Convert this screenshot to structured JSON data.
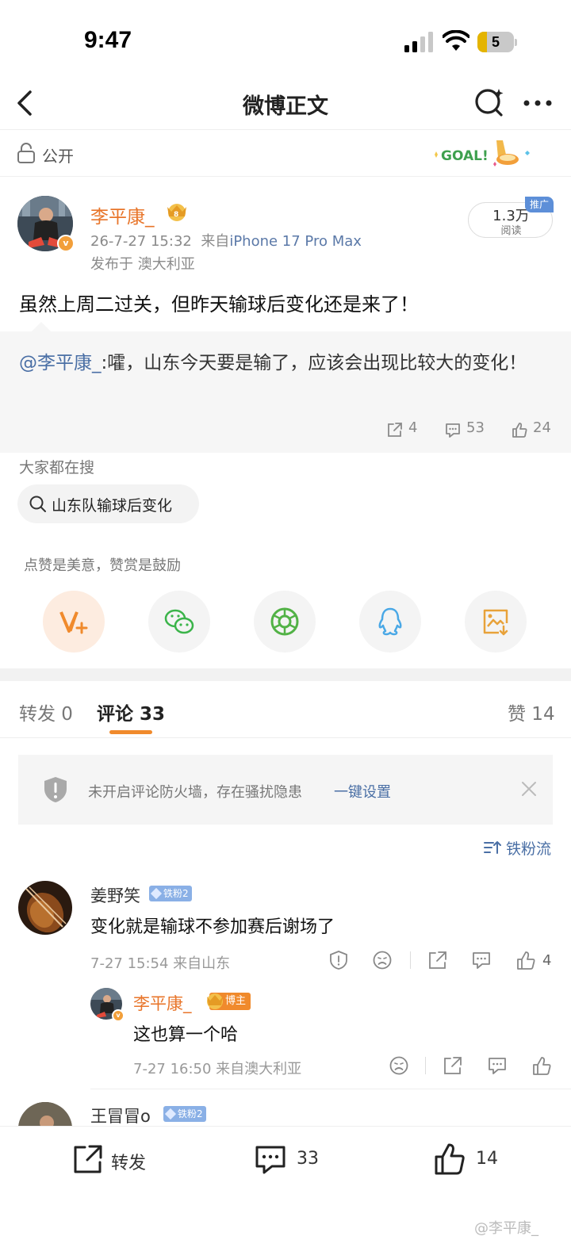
{
  "status_bar": {
    "time": "9:47",
    "battery": "5"
  },
  "nav": {
    "title": "微博正文"
  },
  "visibility": {
    "label": "公开",
    "badge_text": "GOAL!"
  },
  "post": {
    "author": "李平康_",
    "timestamp": "26-7-27 15:32",
    "source_prefix": "来自",
    "device": "iPhone 17 Pro Max",
    "location": "发布于 澳大利亚",
    "reads_count": "1.3万",
    "reads_label": "阅读",
    "promo_tag": "推广",
    "text": "虽然上周二过关，但昨天输球后变化还是来了！"
  },
  "repost": {
    "mention": "@李平康_",
    "text": ":嚯，山东今天要是输了，应该会出现比较大的变化！",
    "shares": "4",
    "comments": "53",
    "likes": "24"
  },
  "search": {
    "heading": "大家都在搜",
    "chip": "山东队输球后变化"
  },
  "reward": {
    "tip": "点赞是美意，赞赏是鼓励"
  },
  "share_targets": [
    {
      "icon": "reward-icon"
    },
    {
      "icon": "wechat-icon"
    },
    {
      "icon": "moments-icon"
    },
    {
      "icon": "qq-icon"
    },
    {
      "icon": "save-image-icon"
    }
  ],
  "tabs": {
    "repost": "转发 0",
    "comment": "评论 33",
    "like": "赞 14"
  },
  "firewall": {
    "text": "未开启评论防火墙，存在骚扰隐患",
    "link": "一键设置"
  },
  "sort": {
    "label": "铁粉流"
  },
  "comments": [
    {
      "name": "姜野笑",
      "badge": "铁粉2",
      "text": "变化就是输球不参加赛后谢场了",
      "meta": "7-27 15:54  来自山东",
      "likes": "4",
      "reply": {
        "name": "李平康_",
        "tag": "博主",
        "text": "这也算一个哈",
        "meta": "7-27 16:50  来自澳大利亚"
      }
    },
    {
      "name": "王冒冒o",
      "badge": "铁粉2"
    }
  ],
  "bottom_bar": {
    "repost": "转发",
    "comments": "33",
    "likes": "14",
    "watermark": "@李平康_"
  },
  "colors": {
    "accent_orange": "#f08a2c",
    "link_blue": "#4a6fa5",
    "name_orange": "#e8752a"
  }
}
